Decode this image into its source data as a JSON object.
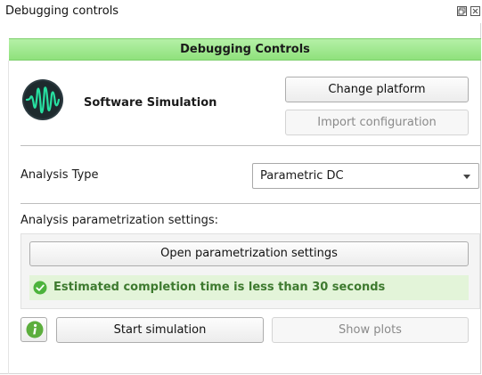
{
  "window": {
    "title": "Debugging controls",
    "float_icon": "float-window-icon",
    "close_icon": "close-icon"
  },
  "header": {
    "title": "Debugging Controls",
    "color": "#9be588"
  },
  "platform": {
    "logo_icon": "waveform-icon",
    "name": "Software Simulation",
    "change_label": "Change platform",
    "import_label": "Import configuration"
  },
  "analysis": {
    "label": "Analysis Type",
    "selected": "Parametric DC"
  },
  "parametrization": {
    "label": "Analysis parametrization settings:",
    "open_label": "Open parametrization settings",
    "status_text": "Estimated completion time is less than 30 seconds",
    "status_icon": "check-circle-icon",
    "status_color": "#3e7a2f"
  },
  "actions": {
    "info_icon": "info-icon",
    "start_label": "Start simulation",
    "plots_label": "Show plots"
  }
}
